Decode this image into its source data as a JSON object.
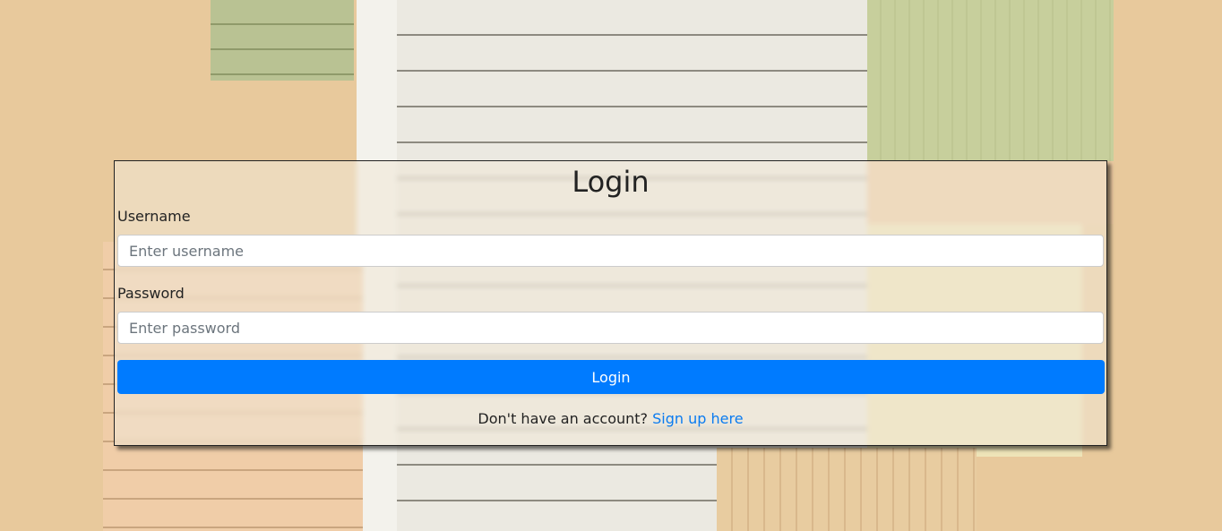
{
  "login": {
    "title": "Login",
    "username_label": "Username",
    "username_placeholder": "Enter username",
    "password_label": "Password",
    "password_placeholder": "Enter password",
    "submit_label": "Login",
    "signup_prompt": "Don't have an account?",
    "signup_link": "Sign up here"
  },
  "colors": {
    "primary_button": "#007bff",
    "link": "#0a7bf0"
  }
}
